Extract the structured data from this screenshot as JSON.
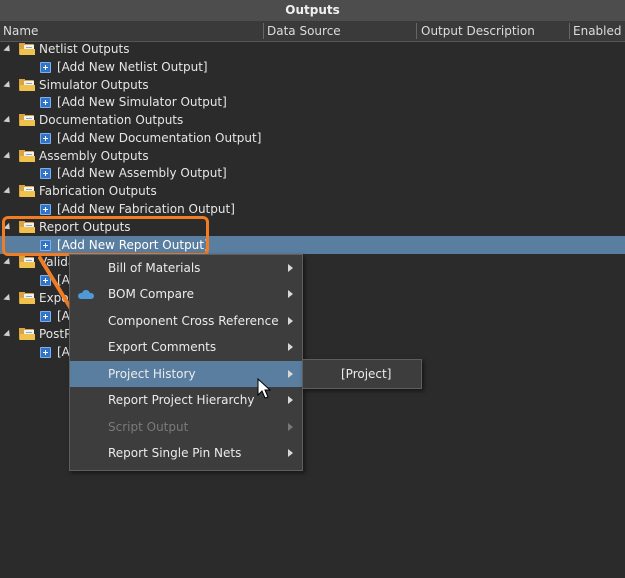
{
  "panel": {
    "title": "Outputs"
  },
  "columns": [
    "Name",
    "Data Source",
    "Output Description",
    "Enabled"
  ],
  "tree": [
    {
      "group": "Netlist Outputs",
      "add": "[Add New Netlist Output]"
    },
    {
      "group": "Simulator Outputs",
      "add": "[Add New Simulator Output]"
    },
    {
      "group": "Documentation Outputs",
      "add": "[Add New Documentation Output]"
    },
    {
      "group": "Assembly Outputs",
      "add": "[Add New Assembly Output]"
    },
    {
      "group": "Fabrication Outputs",
      "add": "[Add New Fabrication Output]"
    },
    {
      "group": "Report Outputs",
      "add": "[Add New Report Output]"
    },
    {
      "group": "Valida",
      "add": "[A"
    },
    {
      "group": "Expo",
      "add": "[A"
    },
    {
      "group": "PostP",
      "add": "[A"
    }
  ],
  "menu": {
    "items": [
      {
        "label": "Bill of Materials"
      },
      {
        "label": "BOM Compare"
      },
      {
        "label": "Component Cross Reference"
      },
      {
        "label": "Export Comments"
      },
      {
        "label": "Project History"
      },
      {
        "label": "Report Project Hierarchy"
      },
      {
        "label": "Script Output"
      },
      {
        "label": "Report Single Pin Nets"
      }
    ],
    "submenu": {
      "label": "[Project]"
    }
  },
  "colors": {
    "highlight": "#f07c24",
    "selection": "#5a7ea0",
    "folder": "#f0c14d",
    "add_icon": "#2f74c9"
  }
}
